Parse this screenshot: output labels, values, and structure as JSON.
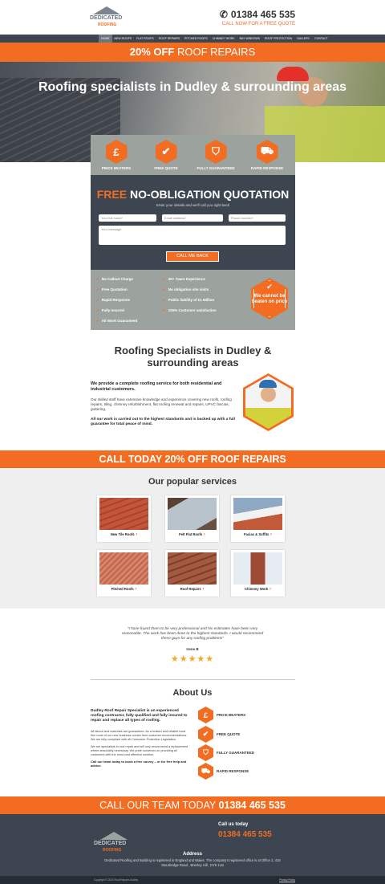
{
  "header": {
    "logo_line1": "DEDICATED",
    "logo_line2": "ROOFING",
    "phone": "01384 465 535",
    "phone_sub": "CALL NOW FOR A FREE QUOTE"
  },
  "nav": [
    "HOME",
    "NEW ROOFS",
    "FLAT ROOFS",
    "ROOF REPAIRS",
    "PITCHED ROOFS",
    "CHIMNEY WORK",
    "BAY WINDOWS",
    "ROOF PROTECTION",
    "GALLERY",
    "CONTACT"
  ],
  "promo": {
    "highlight": "20% OFF",
    "text": " ROOF REPAIRS"
  },
  "hero": {
    "title": "Roofing specialists in Dudley & surrounding areas"
  },
  "features": [
    {
      "icon": "pound-icon",
      "glyph": "£",
      "label": "PRICE BEATERS"
    },
    {
      "icon": "check-icon",
      "glyph": "✔",
      "label": "FREE QUOTE"
    },
    {
      "icon": "shield-icon",
      "glyph": "⛉",
      "label": "FULLY GUARANTEED"
    },
    {
      "icon": "truck-icon",
      "glyph": "⛟",
      "label": "RAPID RESPONSE"
    }
  ],
  "form": {
    "title_highlight": "FREE",
    "title_rest": " NO-OBLIGATION QUOTATION",
    "subtitle": "Enter your details and we'll call you right back",
    "name_placeholder": "Your full name*",
    "email_placeholder": "Email address*",
    "phone_placeholder": "Phone number*",
    "message_placeholder": "Your message",
    "button": "CALL ME BACK"
  },
  "benefits": {
    "col1": [
      "No Callout Charge",
      "Free Quotation",
      "Rapid Response",
      "Fully Insured",
      "All Work Guaranteed"
    ],
    "col2": [
      "20+ Years Experience",
      "No obligation site visits",
      "Public liability of £1 Million",
      "100% Customer satisfaction"
    ],
    "badge": "We cannot be beaten on price"
  },
  "intro": {
    "title": "Roofing Specialists in Dudley & surrounding areas",
    "lead": "We provide a complete roofing service for both residential and industrial customers.",
    "body": "Our skilled staff have extensive knowledge and experience covering new roofs, roofing repairs, tiling, chimney refurbishment, flat roofing renewal and repairs, UPVC fascias, guttering.",
    "bold": "All our work is carried out to the highest standards and is backed up with a full guarantee for total peace of mind."
  },
  "band1": {
    "text": "CALL TODAY 20% OFF ROOF REPAIRS"
  },
  "services": {
    "title": "Our popular services",
    "items": [
      "New Tile Roofs",
      "Felt Flat Roofs",
      "Facias & Soffits",
      "Pitched Roofs",
      "Roof Repairs",
      "Chimney Work"
    ]
  },
  "testimonial": {
    "quote": "\"I have found them to be very professional and his estimates have been very reasonable. The work has been done to the highest standards. I would recommend these guys for any roofing problems\"",
    "name": "Irene B",
    "stars": "★★★★★"
  },
  "about": {
    "title": "About Us",
    "lead": "Dudley Roof Repair Specialist is an experienced roofing contractor, fully qualified and fully insured to repair and replace all types of roofing.",
    "p1": "All labour and materials are guaranteed. As a trusted and reliable local firm most of our new business comes from customer recommendations. We are fully compliant with all Consumer Protection Legislation.",
    "p2": "We are specialists in roof repair and will only recommend a replacement where absolutely necessary. We pride ourselves on providing all customers with the most cost effective solution.",
    "bold": "Call our team today to book a free survey – or for free help and advice.",
    "items": [
      {
        "icon": "pound-icon",
        "glyph": "£",
        "label": "PRICE BEATERS"
      },
      {
        "icon": "check-icon",
        "glyph": "✔",
        "label": "FREE QUOTE"
      },
      {
        "icon": "shield-icon",
        "glyph": "⛉",
        "label": "FULLY GUARANTEED"
      },
      {
        "icon": "truck-icon",
        "glyph": "⛟",
        "label": "RAPID RESPONSE"
      }
    ]
  },
  "band2": {
    "text": "CALL OUR TEAM TODAY ",
    "phone": "01384 465 535"
  },
  "footer": {
    "logo_line1": "DEDICATED",
    "logo_line2": "ROOFING",
    "call_us": "Call us today",
    "phone": "01384 465 535",
    "address_heading": "Address",
    "address": "Dedicated Roofing and Building is registered in England and Wales. The company's registered office is at Office 2, 415 Stourbridge Road , Brierley Hill , DY5 1LB",
    "copyright": "Copyright © 2020 Roof Repairs Dudley",
    "privacy": "Privacy Policy"
  },
  "colors": {
    "accent": "#f26c22",
    "dark": "#3d4650",
    "grey": "#9ca39f"
  }
}
